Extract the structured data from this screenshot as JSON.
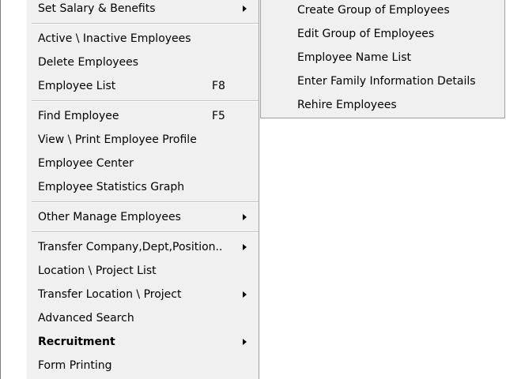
{
  "main_menu": {
    "items": [
      {
        "label": "Set Salary & Benefits",
        "has_submenu": true
      },
      {
        "label": "Active \\ Inactive Employees"
      },
      {
        "label": "Delete Employees"
      },
      {
        "label": "Employee List",
        "shortcut": "F8"
      },
      {
        "label": "Find Employee",
        "shortcut": "F5"
      },
      {
        "label": "View \\ Print Employee Profile"
      },
      {
        "label": "Employee Center"
      },
      {
        "label": "Employee Statistics Graph"
      },
      {
        "label": "Other Manage Employees",
        "has_submenu": true
      },
      {
        "label": "Transfer Company,Dept,Position..",
        "has_submenu": true
      },
      {
        "label": "Location \\ Project List"
      },
      {
        "label": "Transfer Location \\ Project",
        "has_submenu": true
      },
      {
        "label": "Advanced Search"
      },
      {
        "label": "Recruitment",
        "has_submenu": true,
        "bold": true
      },
      {
        "label": "Form Printing"
      }
    ]
  },
  "sub_menu": {
    "items": [
      {
        "label": "Create Group of Employees"
      },
      {
        "label": "Edit Group of Employees"
      },
      {
        "label": "Employee Name List"
      },
      {
        "label": "Enter Family Information Details"
      },
      {
        "label": "Rehire Employees"
      }
    ]
  },
  "colors": {
    "menu_background": "#f0f0f0",
    "menu_border": "#a0a0a0",
    "separator": "#c6c6c6",
    "text": "#000000"
  },
  "icons": {
    "submenu_arrow": "triangle-right-icon"
  }
}
